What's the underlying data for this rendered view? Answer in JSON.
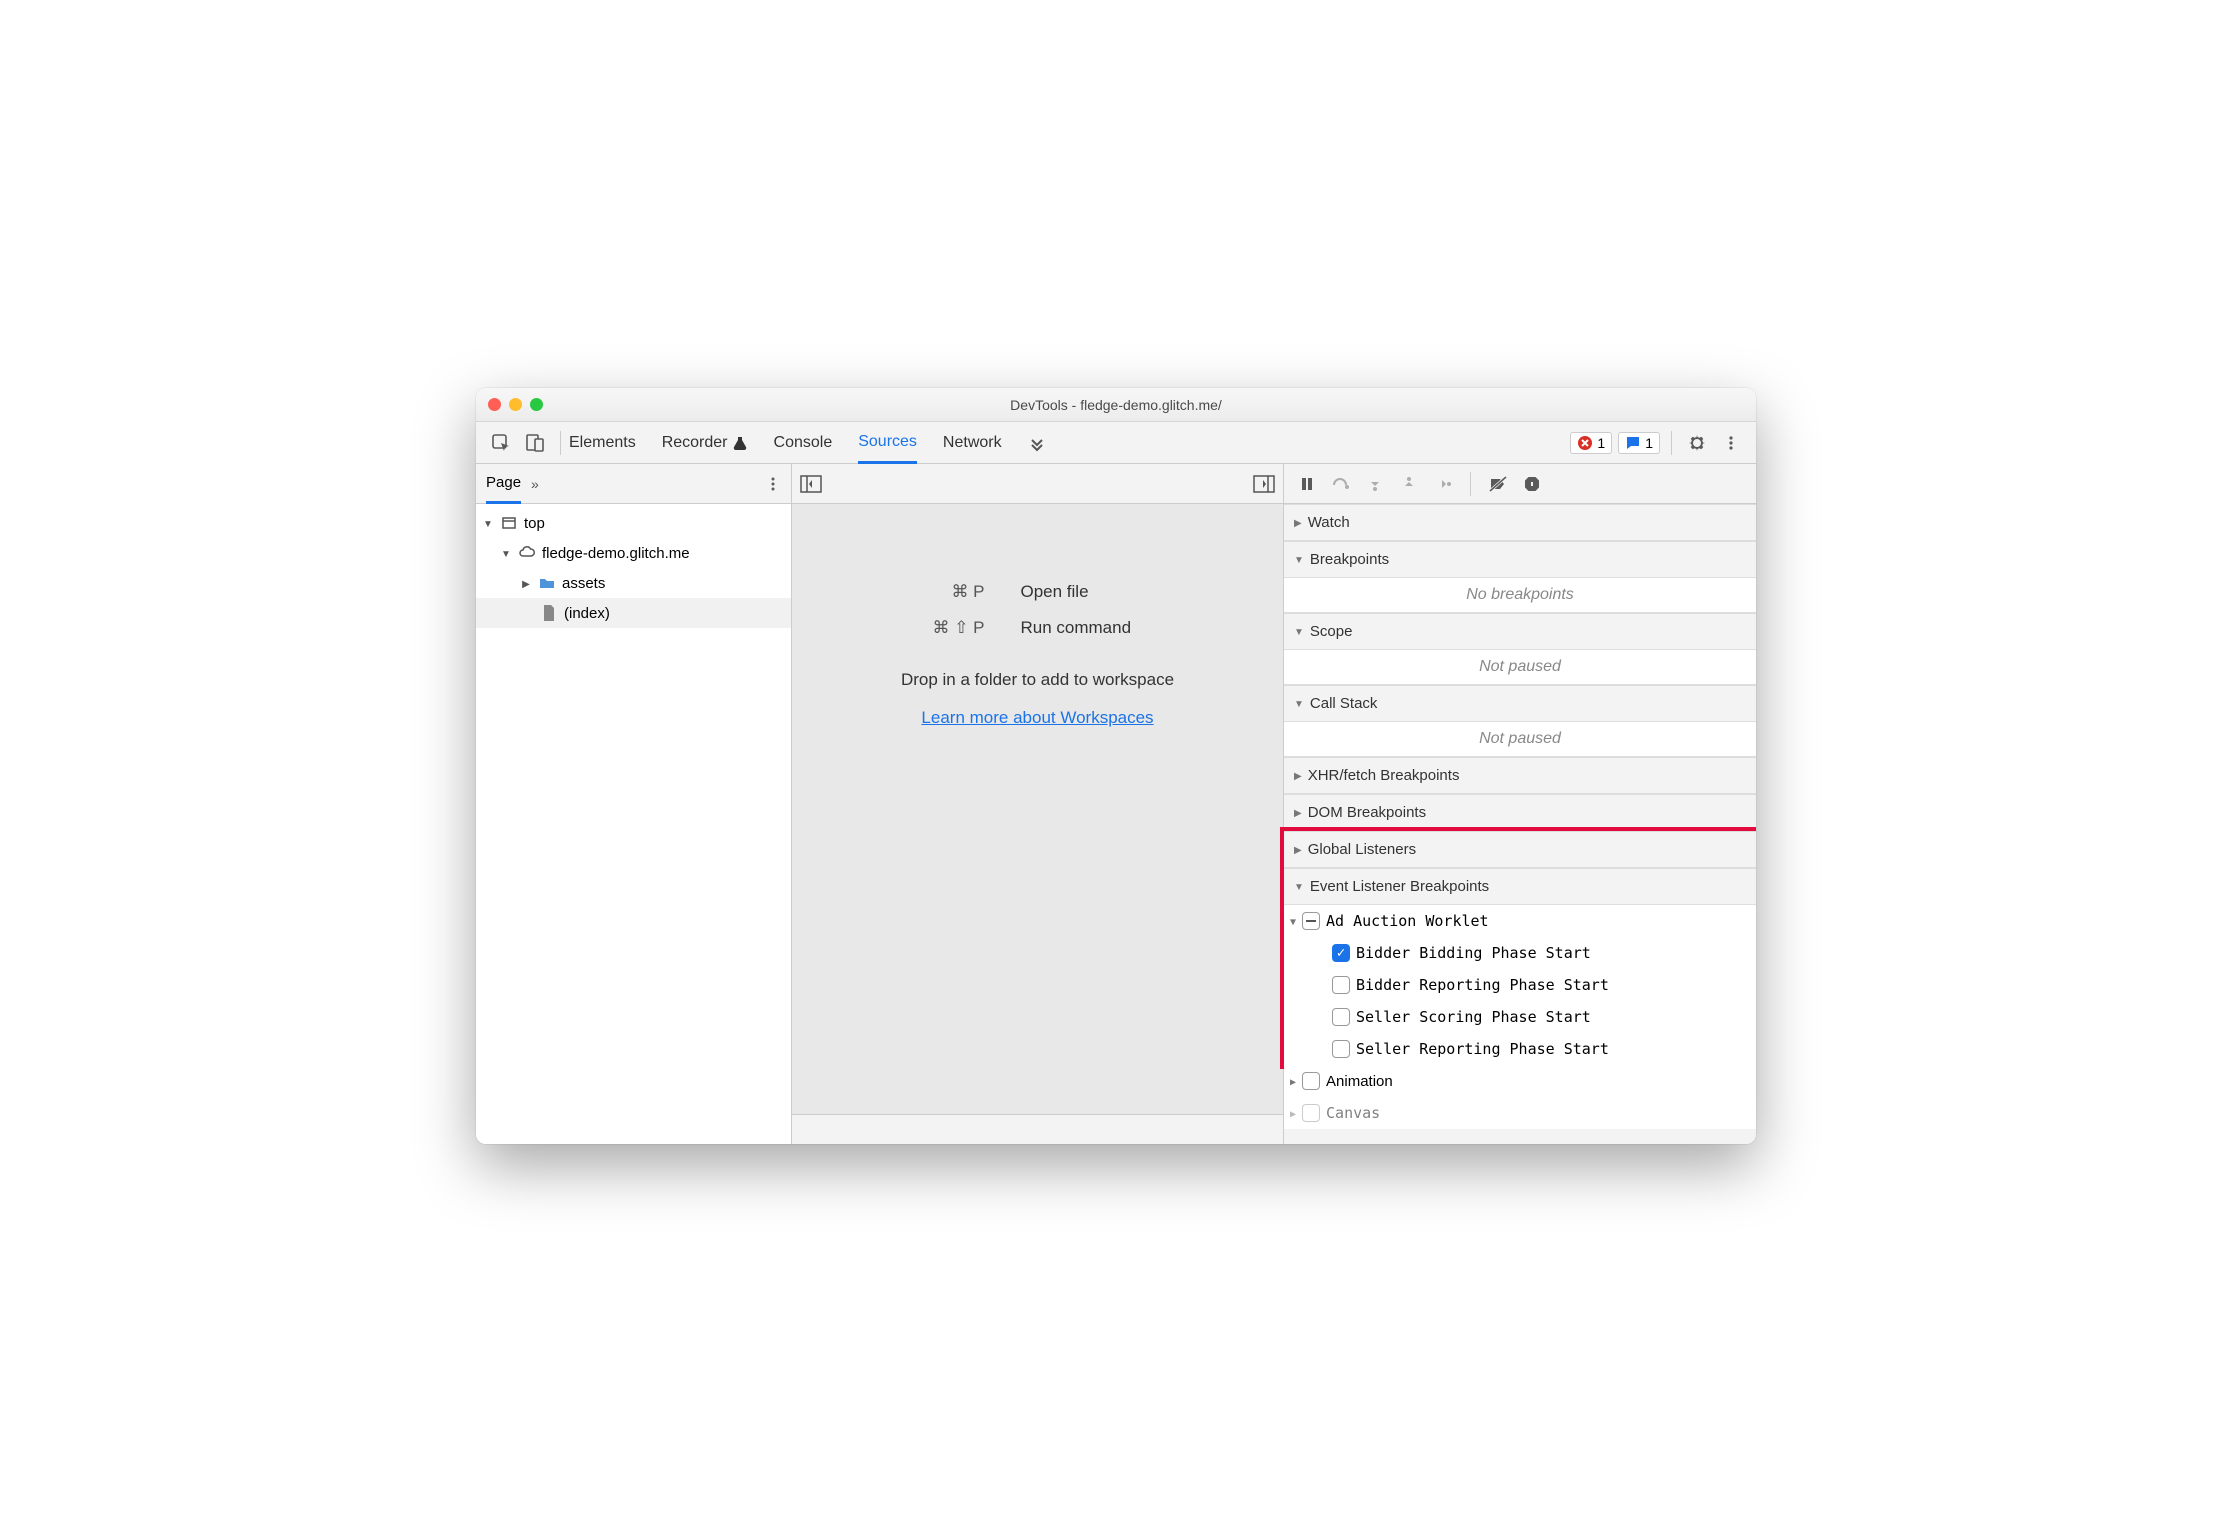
{
  "window": {
    "title": "DevTools - fledge-demo.glitch.me/"
  },
  "toolbar": {
    "tabs": [
      "Elements",
      "Recorder",
      "Console",
      "Sources",
      "Network"
    ],
    "error_count": "1",
    "message_count": "1"
  },
  "left": {
    "tab": "Page",
    "tree": {
      "top": "top",
      "origin": "fledge-demo.glitch.me",
      "assets": "assets",
      "index": "(index)"
    }
  },
  "mid": {
    "open_keys": "⌘ P",
    "open_label": "Open file",
    "run_keys": "⌘ ⇧ P",
    "run_label": "Run command",
    "hint": "Drop in a folder to add to workspace",
    "link": "Learn more about Workspaces"
  },
  "right": {
    "sections": {
      "watch": "Watch",
      "breakpoints": "Breakpoints",
      "breakpoints_empty": "No breakpoints",
      "scope": "Scope",
      "not_paused": "Not paused",
      "call_stack": "Call Stack",
      "xhr": "XHR/fetch Breakpoints",
      "dom": "DOM Breakpoints",
      "global": "Global Listeners",
      "elb": "Event Listener Breakpoints",
      "animation": "Animation",
      "canvas": "Canvas"
    },
    "worklet": {
      "group": "Ad Auction Worklet",
      "items": [
        {
          "label": "Bidder Bidding Phase Start",
          "checked": true
        },
        {
          "label": "Bidder Reporting Phase Start",
          "checked": false
        },
        {
          "label": "Seller Scoring Phase Start",
          "checked": false
        },
        {
          "label": "Seller Reporting Phase Start",
          "checked": false
        }
      ]
    }
  }
}
